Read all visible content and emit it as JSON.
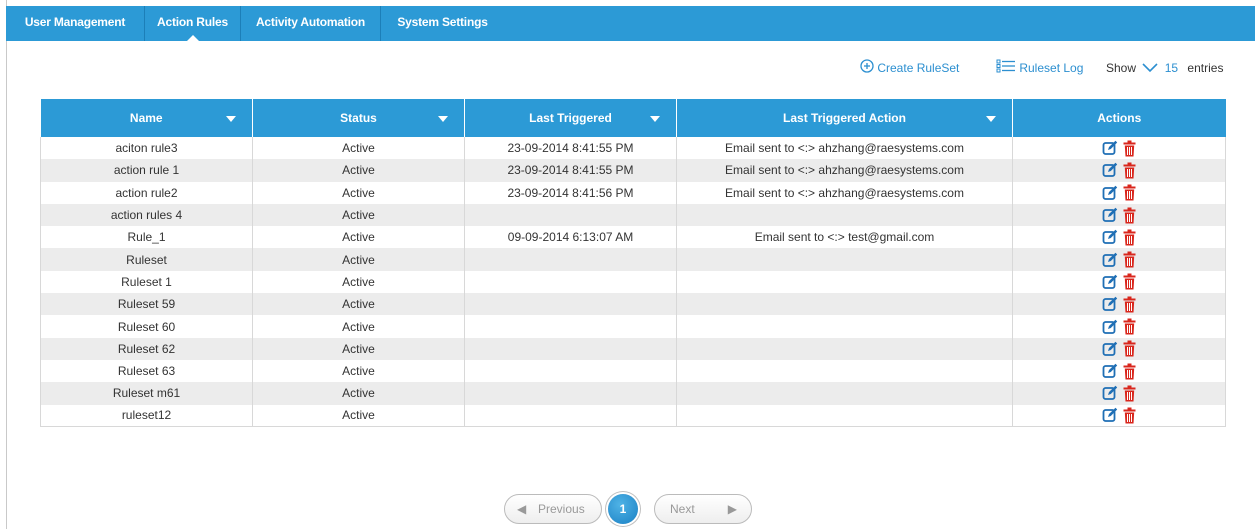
{
  "tabs": [
    {
      "label": "User Management"
    },
    {
      "label": "Action Rules",
      "active": true
    },
    {
      "label": "Activity Automation"
    },
    {
      "label": "System Settings"
    }
  ],
  "toolbar": {
    "create_label": "Create RuleSet",
    "log_label": "Ruleset Log",
    "show_label": "Show",
    "entries_value": "15",
    "entries_label": "entries"
  },
  "table": {
    "columns": [
      "Name",
      "Status",
      "Last Triggered",
      "Last Triggered Action",
      "Actions"
    ],
    "rows": [
      {
        "name": "aciton rule3",
        "status": "Active",
        "last_triggered": "23-09-2014 8:41:55 PM",
        "action": "Email sent to <:> ahzhang@raesystems.com"
      },
      {
        "name": "action rule 1",
        "status": "Active",
        "last_triggered": "23-09-2014 8:41:55 PM",
        "action": "Email sent to <:> ahzhang@raesystems.com"
      },
      {
        "name": "action rule2",
        "status": "Active",
        "last_triggered": "23-09-2014 8:41:56 PM",
        "action": "Email sent to <:> ahzhang@raesystems.com"
      },
      {
        "name": "action rules 4",
        "status": "Active",
        "last_triggered": "",
        "action": ""
      },
      {
        "name": "Rule_1",
        "status": "Active",
        "last_triggered": "09-09-2014 6:13:07 AM",
        "action": "Email sent to <:> test@gmail.com"
      },
      {
        "name": "Ruleset",
        "status": "Active",
        "last_triggered": "",
        "action": ""
      },
      {
        "name": "Ruleset 1",
        "status": "Active",
        "last_triggered": "",
        "action": ""
      },
      {
        "name": "Ruleset 59",
        "status": "Active",
        "last_triggered": "",
        "action": ""
      },
      {
        "name": "Ruleset 60",
        "status": "Active",
        "last_triggered": "",
        "action": ""
      },
      {
        "name": "Ruleset 62",
        "status": "Active",
        "last_triggered": "",
        "action": ""
      },
      {
        "name": "Ruleset 63",
        "status": "Active",
        "last_triggered": "",
        "action": ""
      },
      {
        "name": "Ruleset m61",
        "status": "Active",
        "last_triggered": "",
        "action": ""
      },
      {
        "name": "ruleset12",
        "status": "Active",
        "last_triggered": "",
        "action": ""
      }
    ]
  },
  "pagination": {
    "previous_label": "Previous",
    "current_page": "1",
    "next_label": "Next"
  },
  "colors": {
    "header_blue": "#2c9ad6",
    "link_blue": "#2c8fd0",
    "delete_red": "#d9261c",
    "edit_blue": "#1f6fb5"
  },
  "icons": {
    "create": "plus-circle-icon",
    "log": "list-icon",
    "entries": "chevron-down-icon",
    "edit": "edit-icon",
    "delete": "trash-icon"
  }
}
